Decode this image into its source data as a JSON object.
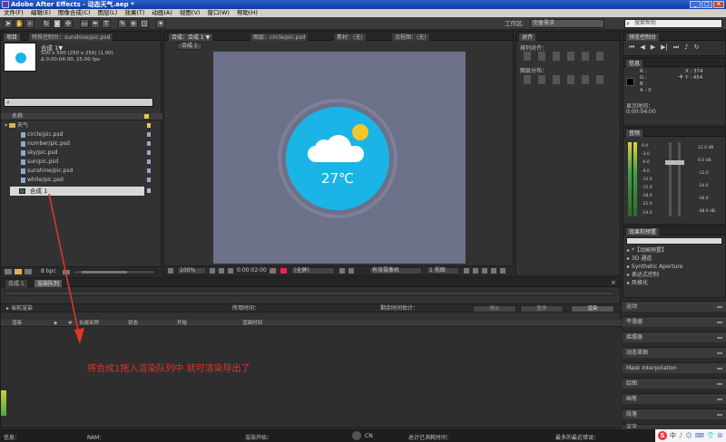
{
  "title": "Adobe After Effects - 动态天气.aep *",
  "menu": [
    "文件(F)",
    "编辑(E)",
    "图像合成(C)",
    "图层(L)",
    "效果(T)",
    "动画(A)",
    "视图(V)",
    "窗口(W)",
    "帮助(H)"
  ],
  "workspace": {
    "label": "工作区:",
    "value": "完备需求"
  },
  "search": {
    "placeholder": "搜索帮助"
  },
  "project": {
    "tab": "项目",
    "tab2": "特殊控制台：sunshine/pic.psd",
    "comp_name": "合成 1▼",
    "comp_info1": "500 x 500 (250 x 250) (1.00)",
    "comp_info2": "Δ 0:00:04:00, 25.00 fps",
    "col_name": "名称",
    "folder": "天气",
    "files": [
      "circle/pic.psd",
      "number/pic.psd",
      "sky/pic.psd",
      "sun/pic.psd",
      "sunshine/pic.psd",
      "white/pic.psd"
    ],
    "comp_item": "合成 1",
    "bpc": "8 bpc"
  },
  "viewer": {
    "tabs": [
      "合成：合成 1 ▼",
      "图层：circle/pic.psd",
      "素材：(无)",
      "流程图：(无)"
    ],
    "crumb": "合成 1",
    "temperature": "27℃",
    "zoom": "100%",
    "timecode": "0:00:02:00",
    "res": "(全屏)",
    "camera": "有效摄像机",
    "views": "1 视图"
  },
  "align": {
    "tab": "对齐",
    "label1": "排列对齐：",
    "label2": "图层分布："
  },
  "preview": {
    "tab": "预览控制台"
  },
  "info": {
    "tab": "信息",
    "r": "R :",
    "g": "G :",
    "b": "B :",
    "a": "A : 0",
    "x": "X : 374",
    "y": "Y : 454",
    "label": "显示时间：",
    "time": "0:00:04:00"
  },
  "audio": {
    "tab": "音频",
    "left": [
      "0.0",
      "-3.0",
      "-6.0",
      "-9.0",
      "-12.0",
      "-15.0",
      "-18.0",
      "-21.0",
      "-24.0"
    ],
    "right": [
      "12.0 dB",
      "0.0 dB",
      "-12.0",
      "-24.0",
      "-36.0",
      "-48.0 dB"
    ]
  },
  "effects": {
    "tab": "效果和预置",
    "items": [
      "*【动画预置】",
      "3D 通道",
      "Synthetic Aperture",
      "表达式控制",
      "风格化"
    ]
  },
  "right_panels": [
    "运动",
    "平滑器",
    "摇摆器",
    "动态草图",
    "Mask Interpolation",
    "绘图",
    "画笔",
    "段落",
    "文字"
  ],
  "render": {
    "tabs": [
      "合成 1",
      "渲染队列"
    ],
    "current": "当前渲染",
    "elapsed": "所用时间：",
    "remaining": "剩余时间估计：",
    "stop": "停止",
    "pause": "暂停",
    "render": "渲染",
    "cols": [
      "渲染",
      "#",
      "合成名称",
      "状态",
      "开始",
      "渲染时间"
    ]
  },
  "annotation": "将合成1拖入渲染队列中 就可渲染导出了",
  "statusbar": {
    "msg": "信息：",
    "ram": "RAM：",
    "start": "渲染开始：",
    "total": "总计已消耗时间：",
    "errors": "最多的最近错误：",
    "cn": "CN"
  },
  "ime": [
    "S",
    "中",
    "♪",
    "☺",
    "⌨",
    "👕",
    "⊞"
  ],
  "colors": {
    "accent": "#1bb4e6",
    "annotation": "#e0342a",
    "viewer_bg": "#6c7088"
  }
}
